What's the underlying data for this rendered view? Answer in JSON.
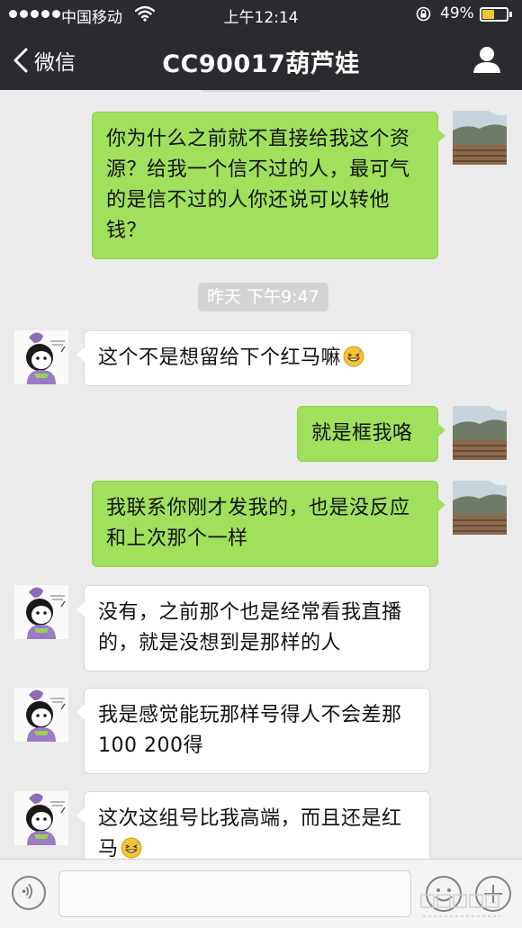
{
  "status_bar": {
    "carrier": "中国移动",
    "time": "上午12:14",
    "battery_percent": "49%",
    "battery_level": 0.49,
    "signal_bars": 5,
    "battery_color": "#f4c430"
  },
  "nav": {
    "back_label": "微信",
    "title": "CC90017葫芦娃",
    "back_icon": "chevron-left-icon",
    "profile_icon": "person-icon"
  },
  "chat": {
    "timestamp": "昨天 下午9:47",
    "messages": [
      {
        "side": "me",
        "text": "你为什么之前就不直接给我这个资源？给我一个信不过的人，最可气的是信不过的人你还说可以转他钱？"
      },
      {
        "side": "other",
        "text": "这个不是想留给下个红马嘛",
        "emoji": "grin-sweat-emoji"
      },
      {
        "side": "me",
        "text": "就是框我咯"
      },
      {
        "side": "me",
        "text": "我联系你刚才发我的，也是没反应和上次那个一样"
      },
      {
        "side": "other",
        "text": "没有，之前那个也是经常看我直播的，就是没想到是那样的人"
      },
      {
        "side": "other",
        "text": "我是感觉能玩那样号得人不会差那100 200得"
      },
      {
        "side": "other",
        "text": "这次这组号比我高端，而且还是红马",
        "emoji": "grin-sweat-emoji"
      }
    ]
  },
  "input_bar": {
    "voice_icon": "voice-icon",
    "emoji_icon": "smiley-icon",
    "plus_icon": "plus-icon"
  },
  "colors": {
    "nav_bg": "#2b2b2f",
    "chat_bg": "#ebebeb",
    "my_bubble": "#a1e05c",
    "their_bubble": "#ffffff"
  }
}
